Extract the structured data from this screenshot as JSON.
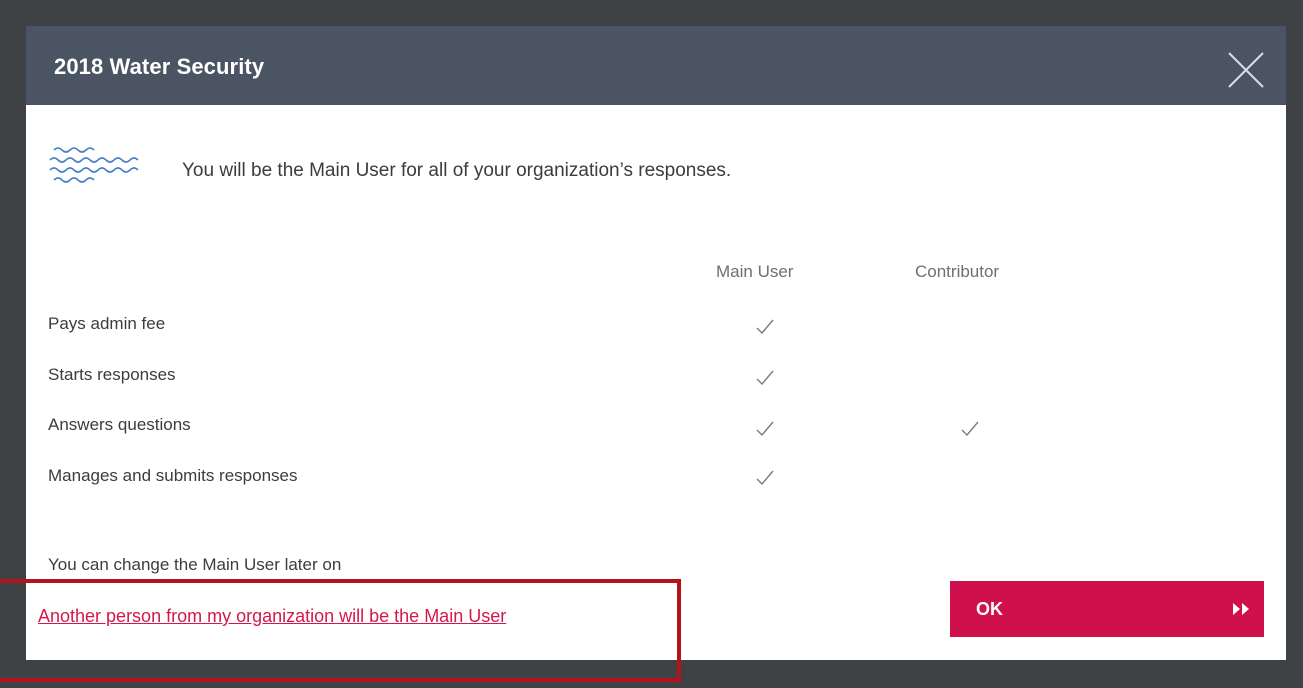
{
  "dialog": {
    "title": "2018 Water Security",
    "close_icon": "close-icon",
    "intro_icon": "water-waves-icon",
    "intro_text": "You will be the Main User for all of your organization’s responses."
  },
  "table": {
    "columns": [
      "Main User",
      "Contributor"
    ],
    "rows": [
      {
        "label": "Pays admin fee",
        "main_user": true,
        "contributor": false
      },
      {
        "label": "Starts responses",
        "main_user": true,
        "contributor": false
      },
      {
        "label": "Answers questions",
        "main_user": true,
        "contributor": true
      },
      {
        "label": "Manages and submits responses",
        "main_user": true,
        "contributor": false
      }
    ],
    "check_icon": "checkmark-icon"
  },
  "footer": {
    "note": "You can change the Main User later on",
    "alt_link": "Another person from my organization will be the Main User",
    "ok_label": "OK",
    "ok_icon": "double-chevron-right-icon"
  },
  "colors": {
    "header_bg": "#4a5463",
    "accent": "#d0104c",
    "overlay_bg": "#3f4244",
    "highlight_border": "#b3141b"
  }
}
